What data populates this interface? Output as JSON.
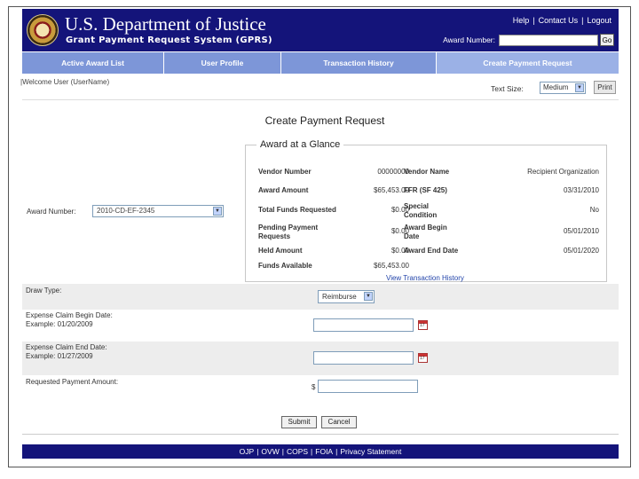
{
  "header": {
    "dept_title": "U.S. Department of Justice",
    "system_title": "Grant Payment Request System (GPRS)",
    "links": [
      "Help",
      "Contact Us",
      "Logout"
    ],
    "award_search_label": "Award Number:",
    "award_search_value": "",
    "go_label": "Go"
  },
  "nav": {
    "tabs": [
      "Active Award List",
      "User Profile",
      "Transaction History",
      "Create Payment Request"
    ],
    "active_tab": "Create Payment Request"
  },
  "welcome": "|Welcome User (UserName)",
  "text_size": {
    "label": "Text Size:",
    "value": "Medium",
    "print_label": "Print"
  },
  "page_title": "Create Payment Request",
  "glance": {
    "title": "Award at a Glance",
    "rows": [
      {
        "l_label": "Vendor Number",
        "l_value": "00000000",
        "r_label": "Vendor Name",
        "r_value": "Recipient Organization"
      },
      {
        "l_label": "Award Amount",
        "l_value": "$65,453.00",
        "r_label": "FFR (SF 425)",
        "r_value": "03/31/2010"
      },
      {
        "l_label": "Total Funds Requested",
        "l_value": "$0.00",
        "r_label": "Special Condition",
        "r_value": "No"
      },
      {
        "l_label": "Pending Payment Requests",
        "l_value": "$0.00",
        "r_label": "Award Begin Date",
        "r_value": "05/01/2010"
      },
      {
        "l_label": "Held Amount",
        "l_value": "$0.00",
        "r_label": "Award End Date",
        "r_value": "05/01/2020"
      },
      {
        "l_label": "Funds Available",
        "l_value": "$65,453.00",
        "r_label": "",
        "r_value": ""
      }
    ],
    "view_history": "View Transaction History"
  },
  "award_number": {
    "label": "Award Number:",
    "value": "2010-CD-EF-2345"
  },
  "form": {
    "draw_type": {
      "label": "Draw Type:",
      "value": "Reimburse"
    },
    "begin_date": {
      "label": "Expense Claim Begin Date:",
      "example": "Example: 01/20/2009",
      "value": ""
    },
    "end_date": {
      "label": "Expense Claim End Date:",
      "example": "Example: 01/27/2009",
      "value": ""
    },
    "amount": {
      "label": "Requested Payment Amount:",
      "currency": "$",
      "value": ""
    },
    "submit_label": "Submit",
    "cancel_label": "Cancel"
  },
  "footer": {
    "links": [
      "OJP",
      "OVW",
      "COPS",
      "FOIA",
      "Privacy Statement"
    ]
  },
  "colors": {
    "header_bg": "#14147a",
    "nav_bg": "#7d96d8",
    "active_tab_bg": "#9bb1e6",
    "link": "#2244aa"
  }
}
